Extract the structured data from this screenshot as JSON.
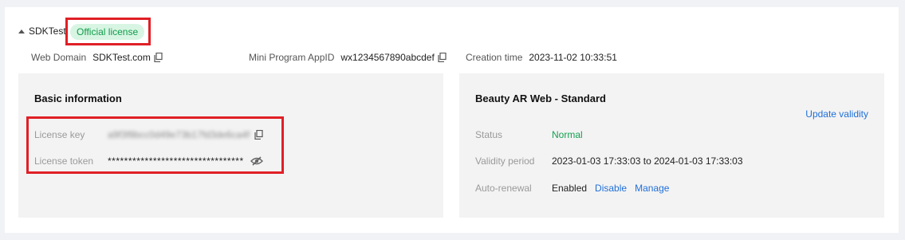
{
  "header": {
    "app_name": "SDKTest",
    "license_badge": "Official license"
  },
  "meta": {
    "web_domain_label": "Web Domain",
    "web_domain_value": "SDKTest.com",
    "mini_program_label": "Mini Program AppID",
    "mini_program_value": "wx1234567890abcdef",
    "creation_label": "Creation time",
    "creation_value": "2023-11-02 10:33:51"
  },
  "basic": {
    "title": "Basic information",
    "license_key_label": "License key",
    "license_key_value": "a9f3f8bcc0d49e73b17fd3de6ca4f",
    "license_token_label": "License token",
    "license_token_value": "*********************************"
  },
  "plan": {
    "title": "Beauty AR Web - Standard",
    "update_link": "Update validity",
    "status_label": "Status",
    "status_value": "Normal",
    "validity_label": "Validity period",
    "validity_value": "2023-01-03 17:33:03 to 2024-01-03 17:33:03",
    "renewal_label": "Auto-renewal",
    "renewal_value": "Enabled",
    "disable_link": "Disable",
    "manage_link": "Manage"
  },
  "colors": {
    "highlight_border": "#e01f26",
    "badge_bg": "#d8f5e3",
    "badge_text": "#0f9d4a",
    "link": "#1f6fd9",
    "status_normal": "#14a050"
  },
  "icons": [
    "caret-up-icon",
    "copy-icon",
    "eye-off-icon"
  ]
}
